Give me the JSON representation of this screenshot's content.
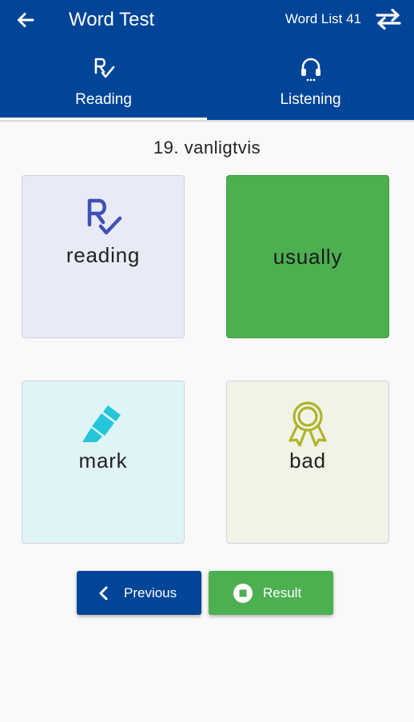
{
  "header": {
    "title": "Word Test",
    "word_list": "Word List 41",
    "back_icon": "arrow-left-icon",
    "swap_icon": "swap-arrows-icon",
    "background_color": "#004597"
  },
  "tabs": [
    {
      "label": "Reading",
      "icon": "reading-check-icon",
      "selected": true
    },
    {
      "label": "Listening",
      "icon": "headphones-icon",
      "selected": false
    }
  ],
  "question": "19. vanligtvis",
  "options": [
    {
      "label": "reading",
      "icon": "reading-check-icon",
      "background": "#e8eaf5",
      "icon_color": "#3f51b5",
      "selected": false
    },
    {
      "label": "usually",
      "icon": "",
      "background": "#4caf50",
      "selected": true
    },
    {
      "label": "mark",
      "icon": "highlighter-icon",
      "background": "#e0f4f8",
      "icon_color": "#26c6da",
      "selected": false
    },
    {
      "label": "bad",
      "icon": "award-ribbon-icon",
      "background": "#f1f3e6",
      "icon_color": "#afb42b",
      "selected": false
    }
  ],
  "buttons": {
    "previous": "Previous",
    "result": "Result"
  },
  "colors": {
    "primary": "#004597",
    "success": "#4caf50"
  }
}
